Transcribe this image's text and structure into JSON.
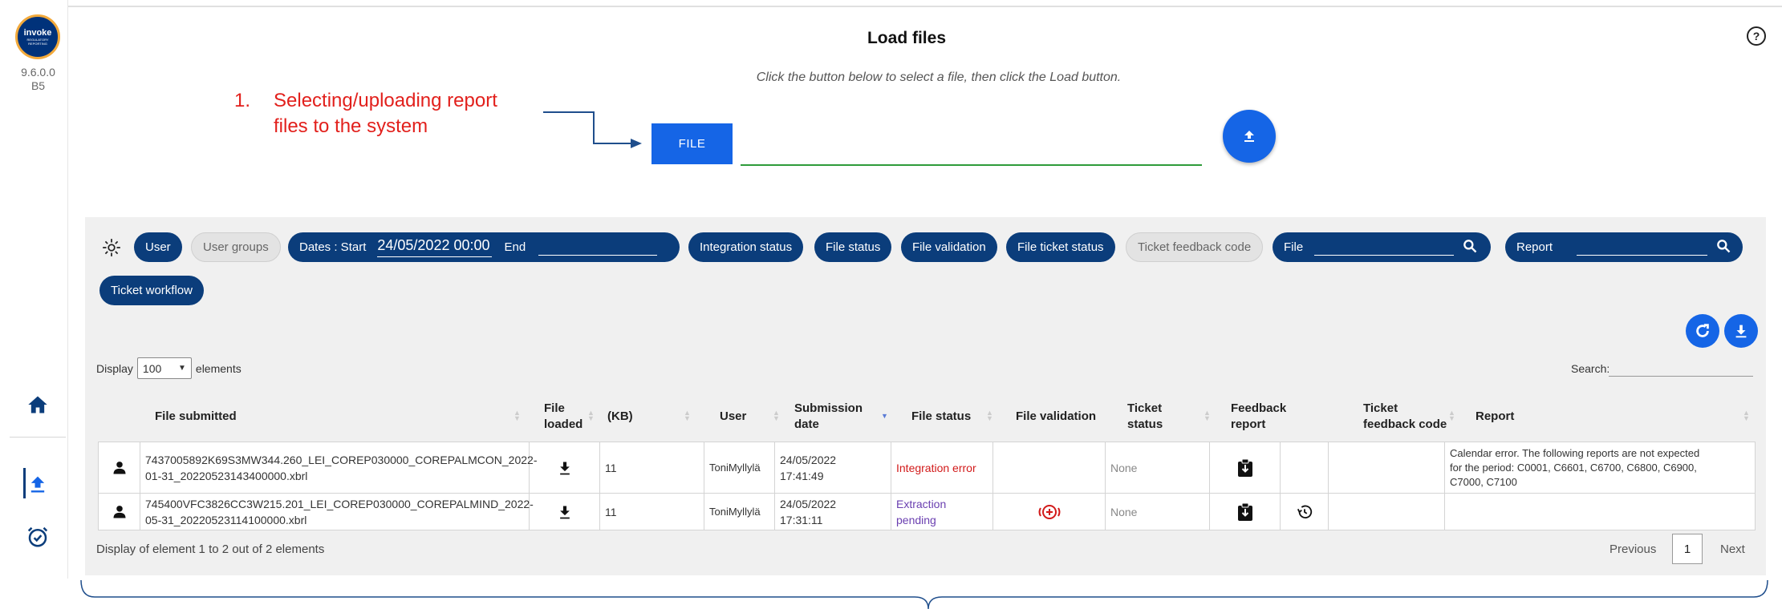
{
  "app": {
    "logo_text": "invoke",
    "logo_subtext": "REGULATORY REPORTING",
    "version_line1": "9.6.0.0",
    "version_line2": "B5"
  },
  "header": {
    "title": "Load files",
    "help_label": "?",
    "subtitle": "Click the button below to select a file, then click the Load button."
  },
  "annotation": {
    "number": "1.",
    "line1": "Selecting/uploading report",
    "line2": "files to the system",
    "color": "#e2201c"
  },
  "upload": {
    "file_button": "FILE",
    "file_value": ""
  },
  "filters": {
    "user": "User",
    "user_groups": "User groups",
    "dates_label": "Dates : Start",
    "start_value": "24/05/2022 00:00",
    "end_label": "End",
    "end_value": "",
    "integration_status": "Integration status",
    "file_status": "File status",
    "file_validation": "File validation",
    "file_ticket_status": "File ticket status",
    "ticket_feedback_code": "Ticket feedback code",
    "file_search_label": "File",
    "file_search_value": "",
    "report_search_label": "Report",
    "report_search_value": "",
    "ticket_workflow": "Ticket workflow"
  },
  "table_controls": {
    "display_label": "Display",
    "display_value": "100",
    "elements_label": "elements",
    "search_label": "Search:",
    "search_value": ""
  },
  "table": {
    "headers": {
      "file_submitted": "File submitted",
      "file_loaded_1": "File",
      "file_loaded_2": "loaded",
      "kb": "(KB)",
      "user": "User",
      "submission_1": "Submission",
      "submission_2": "date",
      "file_status": "File status",
      "file_validation": "File validation",
      "ticket_status_1": "Ticket",
      "ticket_status_2": "status",
      "feedback_1": "Feedback",
      "feedback_2": "report",
      "ticket_feedback_1": "Ticket",
      "ticket_feedback_2": "feedback code",
      "report": "Report"
    },
    "rows": [
      {
        "file_line1": "7437005892K69S3MW344.260_LEI_COREP030000_COREPALMCON_2022-",
        "file_line2": "01-31_20220523143400000.xbrl",
        "kb": "11",
        "user": "ToniMyllylä",
        "date_line1": "24/05/2022",
        "date_line2": "17:41:49",
        "status_line1": "Integration error",
        "status_line2": "",
        "ticket_status": "None",
        "ticket_feedback_code": "",
        "report_line1": "Calendar error. The following reports are not expected",
        "report_line2": "for the period: C0001, C6601, C6700, C6800, C6900,",
        "report_line3": "C7000, C7100"
      },
      {
        "file_line1": "745400VFC3826CC3W215.201_LEI_COREP030000_COREPALMIND_2022-",
        "file_line2": "05-31_20220523114100000.xbrl",
        "kb": "11",
        "user": "ToniMyllylä",
        "date_line1": "24/05/2022",
        "date_line2": "17:31:11",
        "status_line1": "Extraction",
        "status_line2": "pending",
        "ticket_status": "None",
        "ticket_feedback_code": "",
        "report_line1": ""
      }
    ]
  },
  "footer": {
    "info": "Display of element 1 to 2 out of 2 elements",
    "previous": "Previous",
    "page": "1",
    "next": "Next"
  },
  "colors": {
    "navy": "#0b3d7b",
    "blue": "#1565e6",
    "error_red": "#d21a1a",
    "pending_purple": "#6a3fb0",
    "underline_green": "#2e9b3a"
  },
  "icons": {
    "home": "home-icon",
    "upload": "upload-icon",
    "alarm": "alarm-clock-icon",
    "settings": "gear-icon",
    "refresh": "refresh-icon",
    "download": "download-icon",
    "search": "search-icon",
    "person": "person-icon",
    "feedback": "clipboard-download-icon",
    "history": "history-icon",
    "validate": "add-circle-icon"
  }
}
